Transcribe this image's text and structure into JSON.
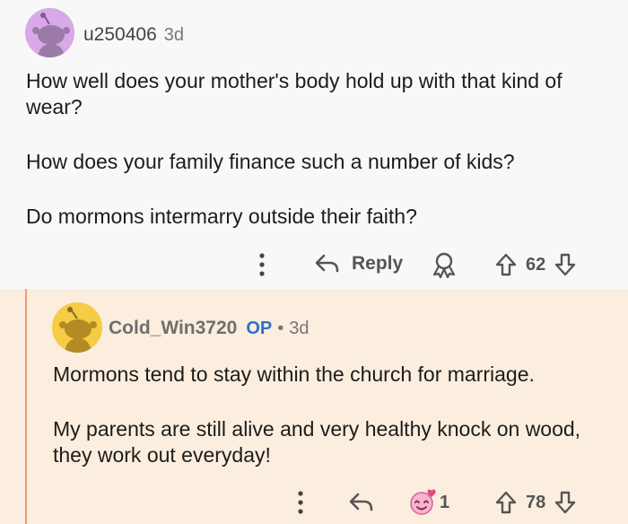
{
  "comment1": {
    "username": "u250406",
    "time": "3d",
    "paragraphs": [
      "How well does your mother's body hold up with that kind of wear?",
      "How does your family finance such a number of kids?",
      "Do mormons intermarry outside their faith?"
    ],
    "actions": {
      "more_icon": "more-vertical-icon",
      "reply_label": "Reply",
      "award_icon": "award-icon",
      "score": "62"
    },
    "avatar_color": "#d9a8e8"
  },
  "comment2": {
    "username": "Cold_Win3720",
    "op_badge": "OP",
    "separator": "•",
    "time": "3d",
    "paragraphs": [
      "Mormons tend to stay within the church for marriage.",
      "My parents are still alive and very healthy knock on wood, they work out everyday!"
    ],
    "actions": {
      "more_icon": "more-vertical-icon",
      "reply_icon": "reply-arrow-icon",
      "award_icon": "wholesome-award-icon",
      "award_count": "1",
      "score": "78"
    },
    "avatar_color": "#f6cb45"
  },
  "colors": {
    "thread_line": "#e79c7a",
    "op_blue": "#2e72c9",
    "reply_background": "#fbeede"
  }
}
